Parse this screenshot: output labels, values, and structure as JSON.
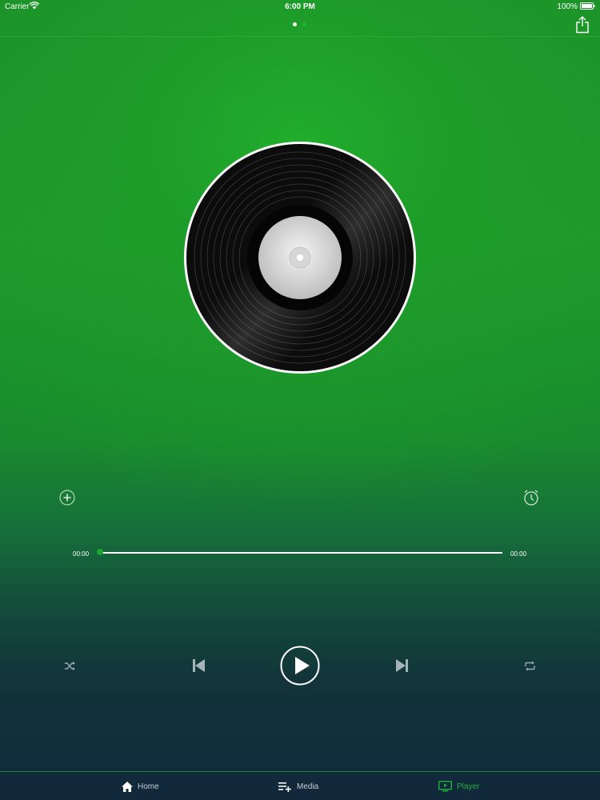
{
  "status_bar": {
    "carrier": "Carrier",
    "time": "6:00 PM",
    "battery": "100%"
  },
  "pager": {
    "page_count": 2,
    "current_page": 1
  },
  "player": {
    "current_time": "00:00",
    "total_time": "00:00",
    "progress": 0
  },
  "tabs": [
    {
      "label": "Home",
      "icon": "house-icon",
      "active": false
    },
    {
      "label": "Media",
      "icon": "playlist-add-icon",
      "active": false
    },
    {
      "label": "Player",
      "icon": "player-screen-icon",
      "active": true
    }
  ],
  "colors": {
    "accent": "#22b33a",
    "tab_bar": "#11293a",
    "background_top": "#1e9c2a",
    "background_bottom": "#11283a"
  }
}
